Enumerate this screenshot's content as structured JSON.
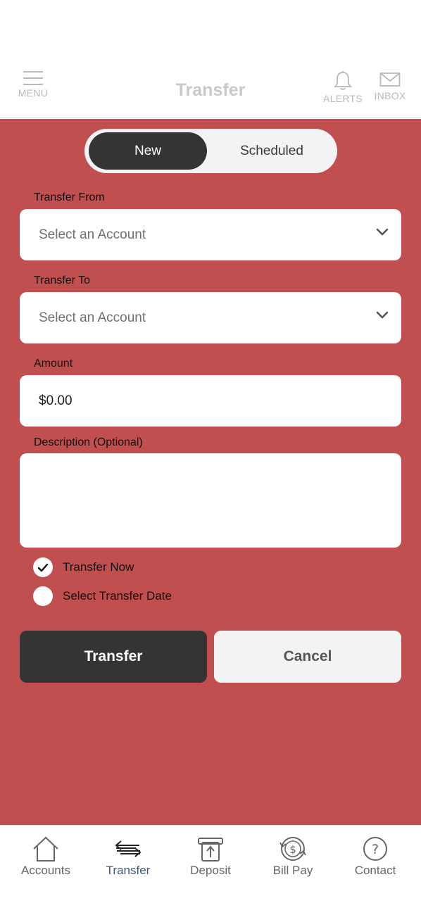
{
  "header": {
    "title": "Transfer",
    "menu_label": "MENU",
    "alerts_label": "ALERTS",
    "inbox_label": "INBOX"
  },
  "segments": {
    "new_label": "New",
    "scheduled_label": "Scheduled",
    "selected": "New"
  },
  "form": {
    "from_label": "Transfer From",
    "from_value": "Select an Account",
    "to_label": "Transfer To",
    "to_value": "Select an Account",
    "amount_label": "Amount",
    "amount_value": "$0.00",
    "description_label": "Description (Optional)",
    "description_value": "",
    "option_now": "Transfer Now",
    "option_date": "Select Transfer Date",
    "option_selected": "Transfer Now"
  },
  "actions": {
    "transfer_label": "Transfer",
    "cancel_label": "Cancel"
  },
  "tabs": [
    {
      "label": "Accounts",
      "icon": "home-icon"
    },
    {
      "label": "Transfer",
      "icon": "transfer-arrows-icon",
      "active": true
    },
    {
      "label": "Deposit",
      "icon": "deposit-icon"
    },
    {
      "label": "Bill Pay",
      "icon": "bill-pay-icon"
    },
    {
      "label": "Contact",
      "icon": "question-icon"
    }
  ],
  "colors": {
    "accent": "#c24f50",
    "dark": "#343434",
    "light": "#f2f3f5",
    "active_tab": "#3a5a7a"
  }
}
